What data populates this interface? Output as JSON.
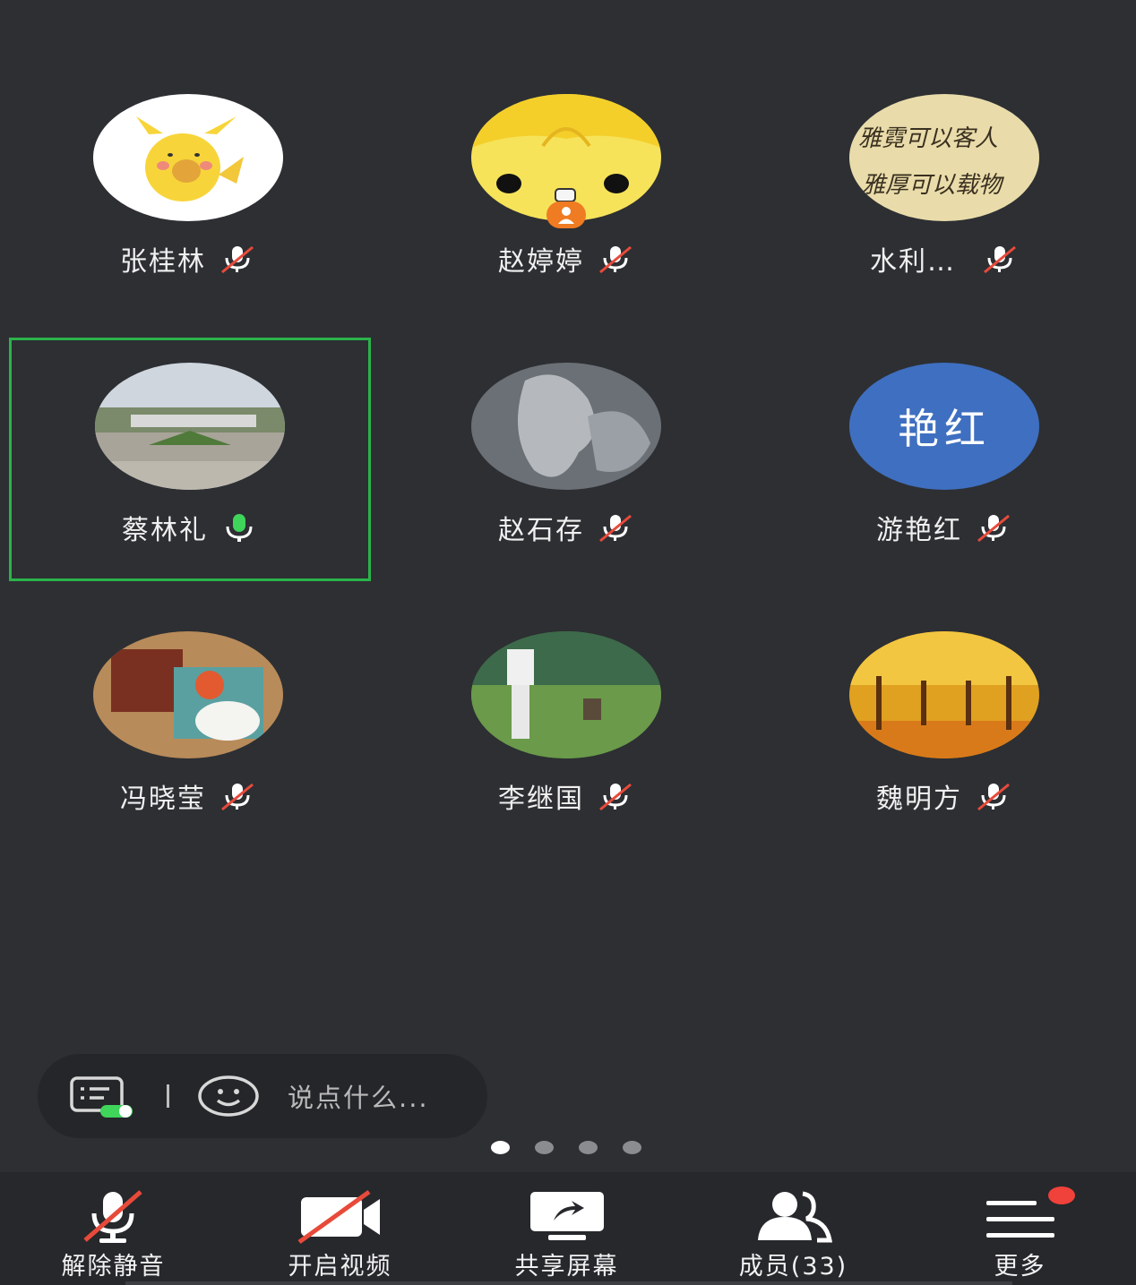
{
  "participants": [
    {
      "name": "张桂林",
      "mic": "muted",
      "avatar": "pikachu-image"
    },
    {
      "name": "赵婷婷",
      "mic": "muted",
      "avatar": "cartoon-face-image",
      "host": true
    },
    {
      "name": "水利…",
      "mic": "muted",
      "avatar": "calligraphy-image",
      "avatar_text_line1": "雅霓可以客人",
      "avatar_text_line2": "雅厚可以载物"
    },
    {
      "name": "蔡林礼",
      "mic": "speaking",
      "avatar": "plaza-photo",
      "active": true
    },
    {
      "name": "赵石存",
      "mic": "muted",
      "avatar": "stone-photo"
    },
    {
      "name": "游艳红",
      "mic": "muted",
      "avatar": "text-avatar",
      "avatar_text": "艳红",
      "avatar_color": "#3f6fc0"
    },
    {
      "name": "冯晓莹",
      "mic": "muted",
      "avatar": "fox-doll-photo"
    },
    {
      "name": "李继国",
      "mic": "muted",
      "avatar": "lawn-photo"
    },
    {
      "name": "魏明方",
      "mic": "muted",
      "avatar": "autumn-trees-photo"
    }
  ],
  "chat": {
    "placeholder": "说点什么..."
  },
  "pager": {
    "count": 4,
    "active_index": 0
  },
  "toolbar": {
    "unmute_label": "解除静音",
    "video_label": "开启视频",
    "share_label": "共享屏幕",
    "members_label": "成员(33)",
    "more_label": "更多"
  },
  "colors": {
    "background": "#2d2f33",
    "active_border": "#2bb34b",
    "speaking_mic": "#3fd45a",
    "muted_slash": "#e84a3a",
    "notification": "#f0413a"
  }
}
